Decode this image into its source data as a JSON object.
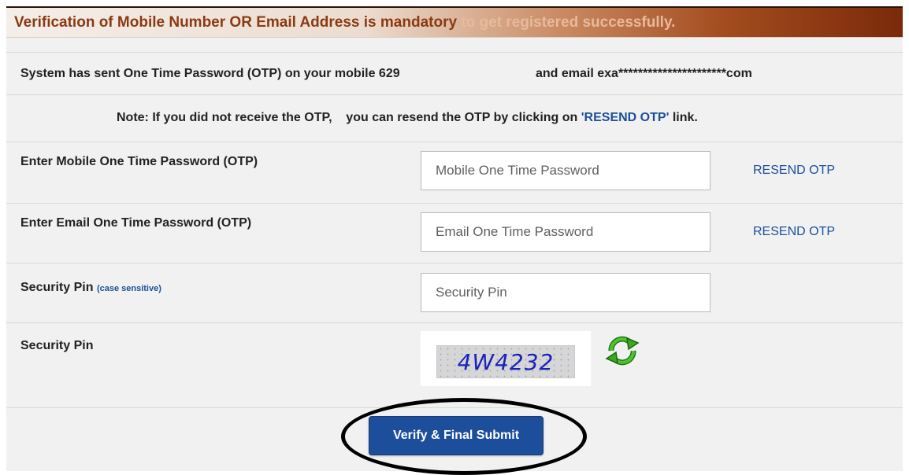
{
  "banner": {
    "text_main": "Verification of Mobile Number OR Email Address is mandatory ",
    "text_fade": "to get registered successfully."
  },
  "info": {
    "otp_sent_prefix": "System has sent One Time Password (OTP) on your mobile 629",
    "otp_sent_email": "and email exa**********************com",
    "note_prefix": "Note: If you did not receive the OTP,    you can resend the OTP by clicking on ",
    "note_link": "'RESEND OTP'",
    "note_suffix": " link."
  },
  "form": {
    "mobile_label": "Enter Mobile One Time Password (OTP)",
    "mobile_placeholder": "Mobile One Time Password",
    "email_label": "Enter Email One Time Password (OTP)",
    "email_placeholder": "Email One Time Password",
    "resend_label": "RESEND OTP",
    "pin_label": "Security Pin",
    "pin_hint": "(case sensitive)",
    "pin_placeholder": "Security Pin",
    "captcha_label": "Security Pin",
    "captcha_text": "4W4232",
    "refresh_icon": "refresh-icon",
    "submit_label": "Verify & Final Submit"
  },
  "colors": {
    "accent_blue": "#1d4e9b",
    "banner_text": "#8a3a12",
    "banner_dark": "#7a2a0a"
  }
}
